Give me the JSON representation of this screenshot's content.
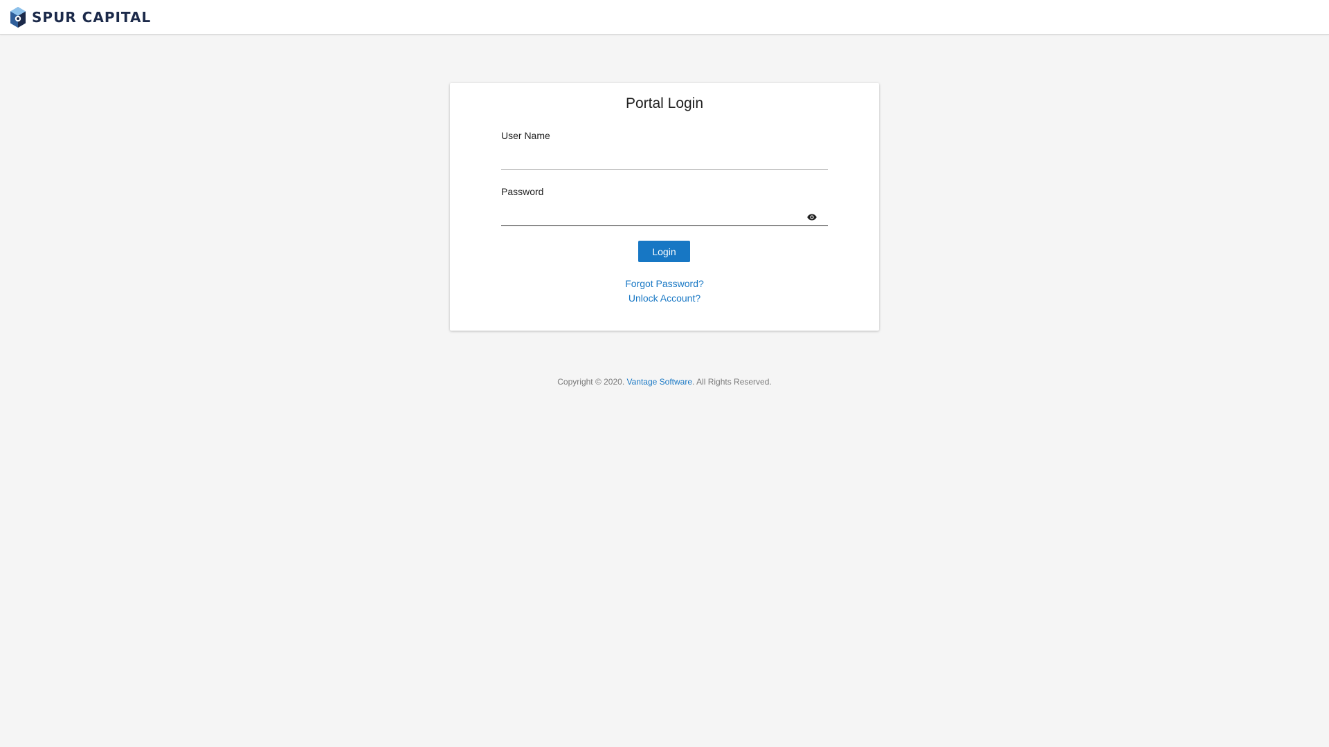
{
  "header": {
    "brand_name": "SPUR CAPITAL",
    "logo_icon": "hexagon-logo-icon",
    "brand_color": "#1c2a4a"
  },
  "login": {
    "title": "Portal Login",
    "username_label": "User Name",
    "username_value": "",
    "password_label": "Password",
    "password_value": "",
    "password_toggle_icon": "eye-icon",
    "login_button": "Login",
    "forgot_password": "Forgot Password?",
    "unlock_account": "Unlock Account?"
  },
  "footer": {
    "prefix": "Copyright © 2020. ",
    "company_link": "Vantage Software",
    "suffix": ". All Rights Reserved."
  },
  "colors": {
    "accent": "#1777c4",
    "background": "#f5f5f5",
    "card": "#ffffff"
  }
}
